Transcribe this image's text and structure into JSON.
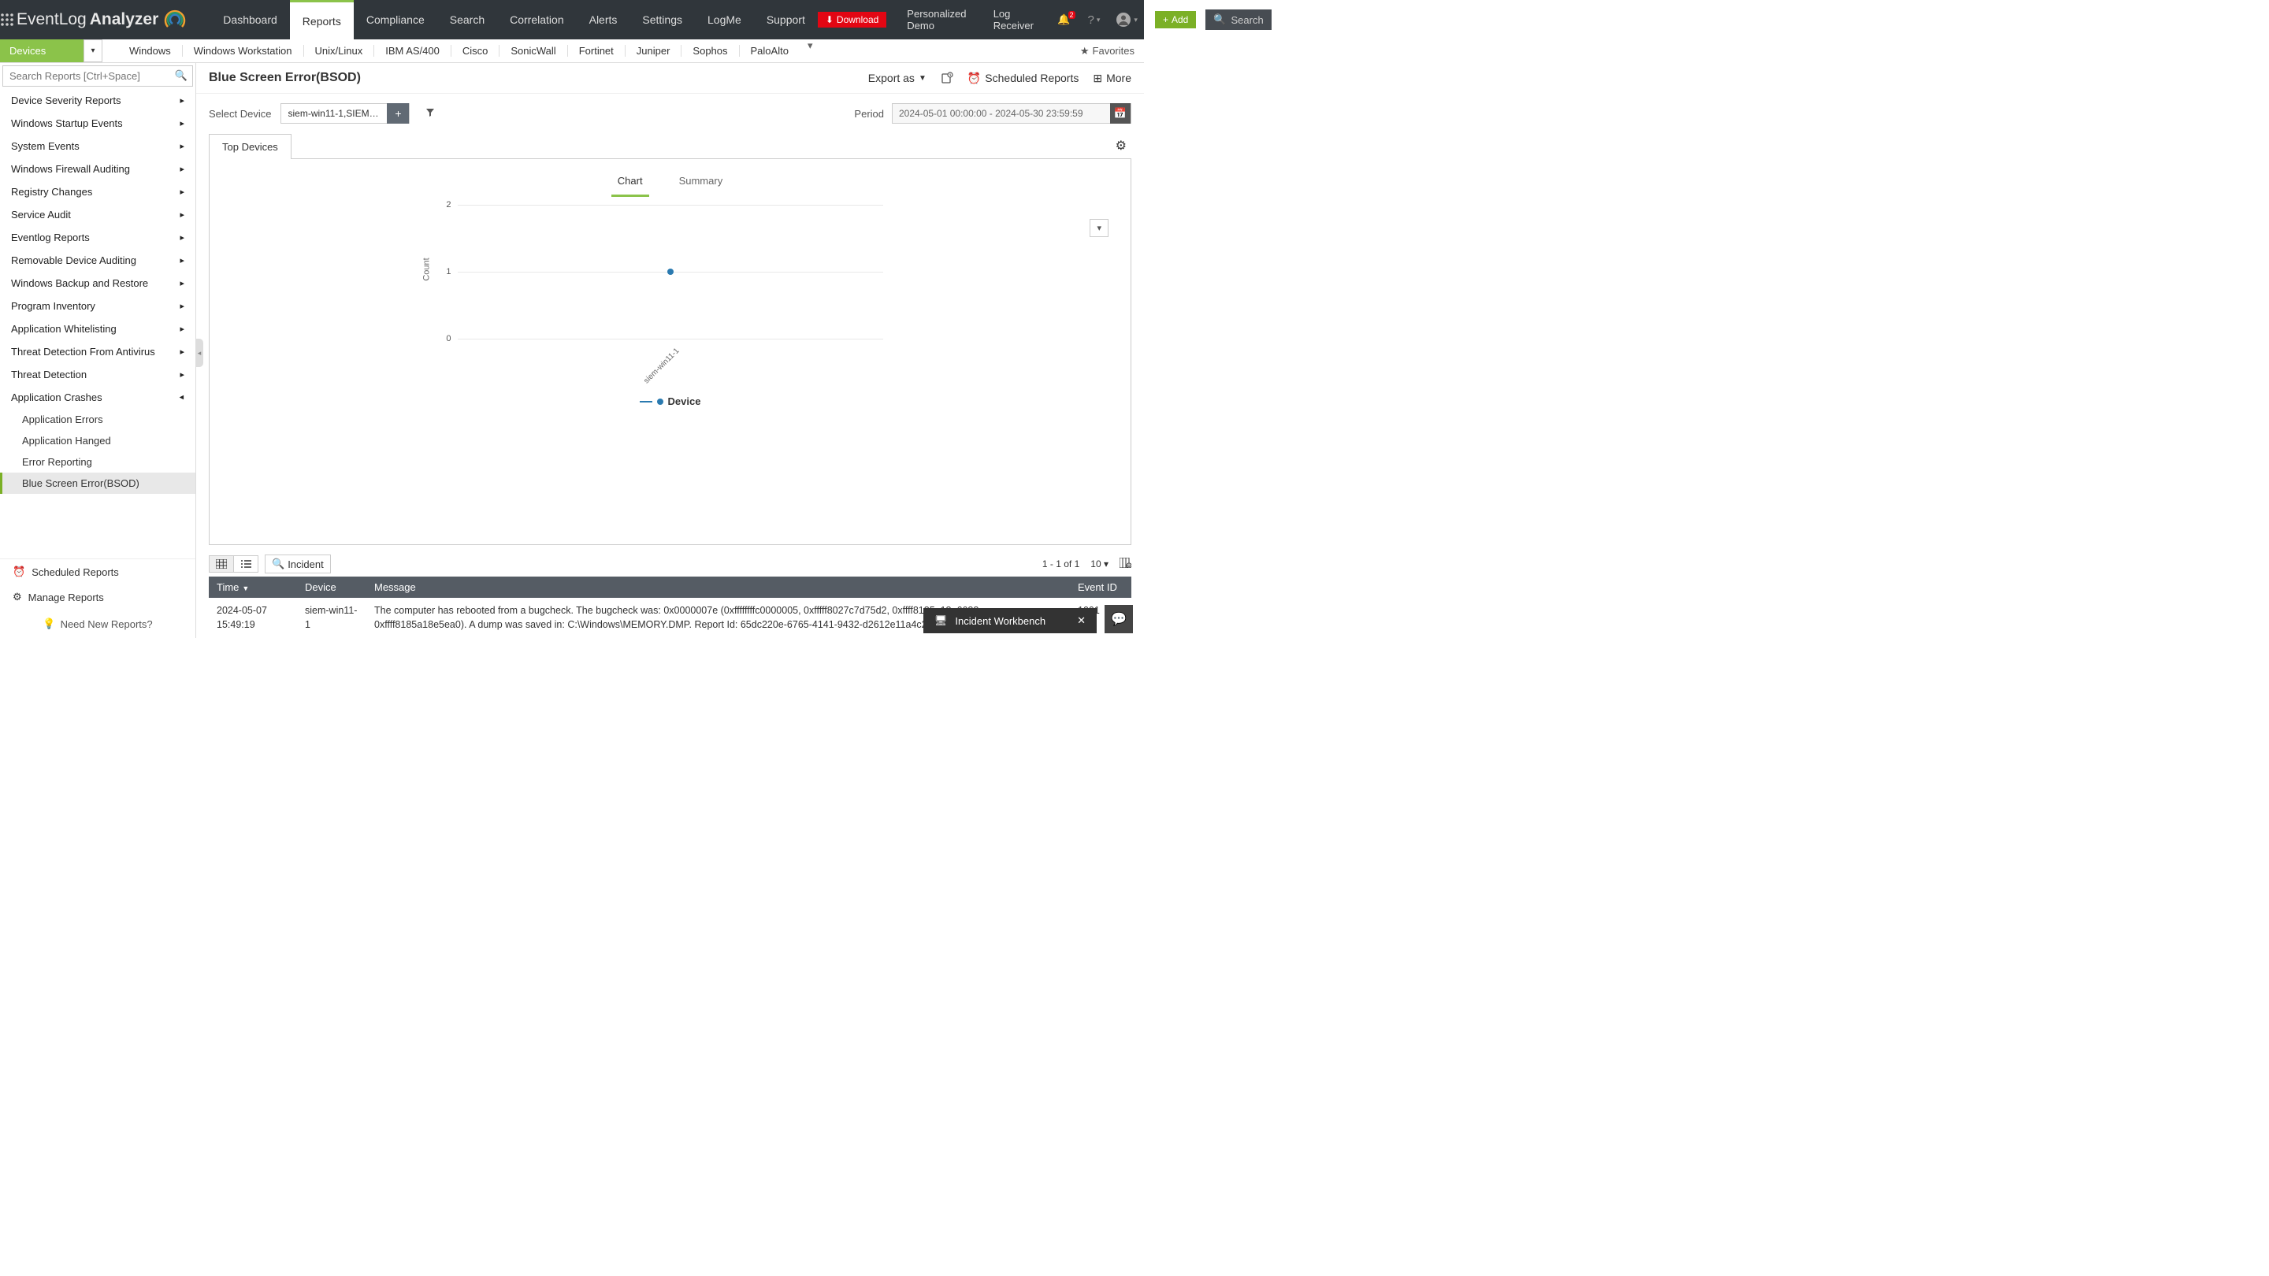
{
  "topbar": {
    "logo_prefix": "EventLog",
    "logo_suffix": "Analyzer",
    "tabs": [
      "Dashboard",
      "Reports",
      "Compliance",
      "Search",
      "Correlation",
      "Alerts",
      "Settings",
      "LogMe",
      "Support"
    ],
    "active_tab": "Reports",
    "download": "Download",
    "demo": "Personalized Demo",
    "log_receiver": "Log Receiver",
    "notif_count": "2",
    "add": "Add",
    "search_placeholder": "Search"
  },
  "subbar": {
    "dropdown": "Devices",
    "tabs": [
      "Windows",
      "Windows Workstation",
      "Unix/Linux",
      "IBM AS/400",
      "Cisco",
      "SonicWall",
      "Fortinet",
      "Juniper",
      "Sophos",
      "PaloAlto"
    ],
    "favorites": "Favorites"
  },
  "sidebar": {
    "search_placeholder": "Search Reports [Ctrl+Space]",
    "items": [
      "Device Severity Reports",
      "Windows Startup Events",
      "System Events",
      "Windows Firewall Auditing",
      "Registry Changes",
      "Service Audit",
      "Eventlog Reports",
      "Removable Device Auditing",
      "Windows Backup and Restore",
      "Program Inventory",
      "Application Whitelisting",
      "Threat Detection From Antivirus",
      "Threat Detection",
      "Application Crashes"
    ],
    "sub_items": [
      "Application Errors",
      "Application Hanged",
      "Error Reporting",
      "Blue Screen Error(BSOD)"
    ],
    "active_sub": "Blue Screen Error(BSOD)",
    "scheduled": "Scheduled Reports",
    "manage": "Manage Reports",
    "need": "Need New Reports?"
  },
  "header": {
    "title": "Blue Screen Error(BSOD)",
    "export": "Export as",
    "scheduled": "Scheduled Reports",
    "more": "More"
  },
  "filter": {
    "select_device": "Select Device",
    "device_value": "siem-win11-1,SIEM-W2...",
    "period": "Period",
    "period_value": "2024-05-01 00:00:00 - 2024-05-30 23:59:59"
  },
  "chart": {
    "outer_tab": "Top Devices",
    "inner_tabs": [
      "Chart",
      "Summary"
    ],
    "active_inner": "Chart",
    "legend": "Device"
  },
  "chart_data": {
    "type": "scatter",
    "ylabel": "Count",
    "yticks": [
      0,
      1,
      2
    ],
    "ylim": [
      0,
      2
    ],
    "categories": [
      "siem-win11-1"
    ],
    "series": [
      {
        "name": "Device",
        "values": [
          1
        ]
      }
    ]
  },
  "toolbar": {
    "incident": "Incident",
    "pager": "1 - 1 of 1",
    "page_size": "10"
  },
  "table": {
    "columns": [
      "Time",
      "Device",
      "Message",
      "Event ID"
    ],
    "rows": [
      {
        "time": "2024-05-07 15:49:19",
        "device": "siem-win11-1",
        "message": "The computer has rebooted from a bugcheck. The bugcheck was: 0x0000007e (0xffffffffc0000005, 0xfffff8027c7d75d2, 0xffff8185a18e6688, 0xffff8185a18e5ea0). A dump was saved in: C:\\Windows\\MEMORY.DMP. Report Id: 65dc220e-6765-4141-9432-d2612e11a4c2.",
        "event_id": "1001"
      }
    ]
  },
  "footer": {
    "workbench": "Incident Workbench"
  }
}
